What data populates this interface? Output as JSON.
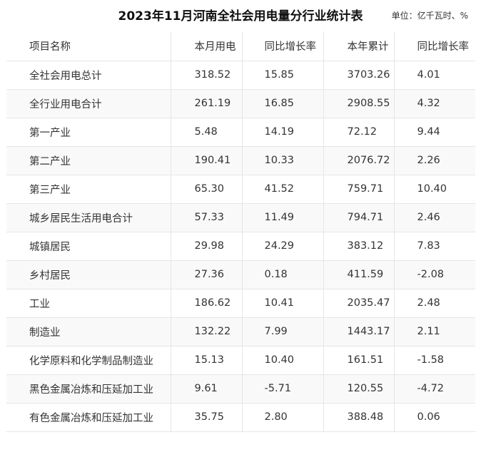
{
  "title": "2023年11月河南全社会用电量分行业统计表",
  "unit": "单位：亿千瓦时、%",
  "table": {
    "headers": [
      "项目名称",
      "本月用电",
      "同比增长率",
      "本年累计",
      "同比增长率"
    ],
    "rows": [
      [
        "全社会用电总计",
        "318.52",
        "15.85",
        "3703.26",
        "4.01"
      ],
      [
        "全行业用电合计",
        "261.19",
        "16.85",
        "2908.55",
        "4.32"
      ],
      [
        "第一产业",
        "5.48",
        "14.19",
        "72.12",
        "9.44"
      ],
      [
        "第二产业",
        "190.41",
        "10.33",
        "2076.72",
        "2.26"
      ],
      [
        "第三产业",
        "65.30",
        "41.52",
        "759.71",
        "10.40"
      ],
      [
        "城乡居民生活用电合计",
        "57.33",
        "11.49",
        "794.71",
        "2.46"
      ],
      [
        "城镇居民",
        "29.98",
        "24.29",
        "383.12",
        "7.83"
      ],
      [
        "乡村居民",
        "27.36",
        "0.18",
        "411.59",
        "-2.08"
      ],
      [
        "工业",
        "186.62",
        "10.41",
        "2035.47",
        "2.48"
      ],
      [
        "制造业",
        "132.22",
        "7.99",
        "1443.17",
        "2.11"
      ],
      [
        "化学原料和化学制品制造业",
        "15.13",
        "10.40",
        "161.51",
        "-1.58"
      ],
      [
        "黑色金属冶炼和压延加工业",
        "9.61",
        "-5.71",
        "120.55",
        "-4.72"
      ],
      [
        "有色金属冶炼和压延加工业",
        "35.75",
        "2.80",
        "388.48",
        "0.06"
      ]
    ]
  }
}
